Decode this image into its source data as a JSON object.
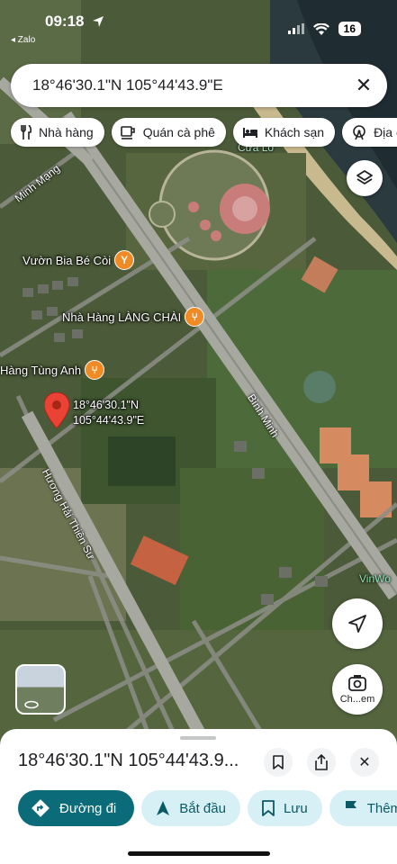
{
  "status_bar": {
    "time": "09:18",
    "back_app": "◂ Zalo",
    "battery": "16"
  },
  "search": {
    "query": "18°46'30.1\"N 105°44'43.9\"E"
  },
  "chips": [
    {
      "label": "Nhà hàng",
      "icon": "fork-knife-icon"
    },
    {
      "label": "Quán cà phê",
      "icon": "coffee-icon"
    },
    {
      "label": "Khách sạn",
      "icon": "bed-icon"
    },
    {
      "label": "Địa c",
      "icon": "attraction-icon"
    }
  ],
  "map": {
    "roads": {
      "minh_mang": "Minh Mạng",
      "binh_minh": "Bình Minh",
      "huong_hai": "Hương Hải Thiền Sư"
    },
    "pois": {
      "cua_lo": "Cửa Lò",
      "vuon_bia": "Vườn Bia Bé Còi",
      "lang_chai": "Nhà Hàng LÀNG CHÀI",
      "tung_anh": "Hàng Tùng Anh",
      "vinwo": "VinWo"
    },
    "pin": {
      "line1": "18°46'30.1\"N",
      "line2": "105°44'43.9\"E",
      "color": "#ea4335"
    }
  },
  "controls": {
    "lens_label": "Ch...em"
  },
  "sheet": {
    "title": "18°46'30.1\"N 105°44'43.9...",
    "actions": [
      {
        "label": "Đường đi",
        "icon": "directions-icon"
      },
      {
        "label": "Bắt đầu",
        "icon": "navigation-arrow-icon"
      },
      {
        "label": "Lưu",
        "icon": "bookmark-icon"
      },
      {
        "label": "Thêm",
        "icon": "flag-icon"
      }
    ]
  },
  "colors": {
    "accent": "#0b6b78",
    "accent_light": "#d7f0f5",
    "poi": "#f08a24"
  }
}
